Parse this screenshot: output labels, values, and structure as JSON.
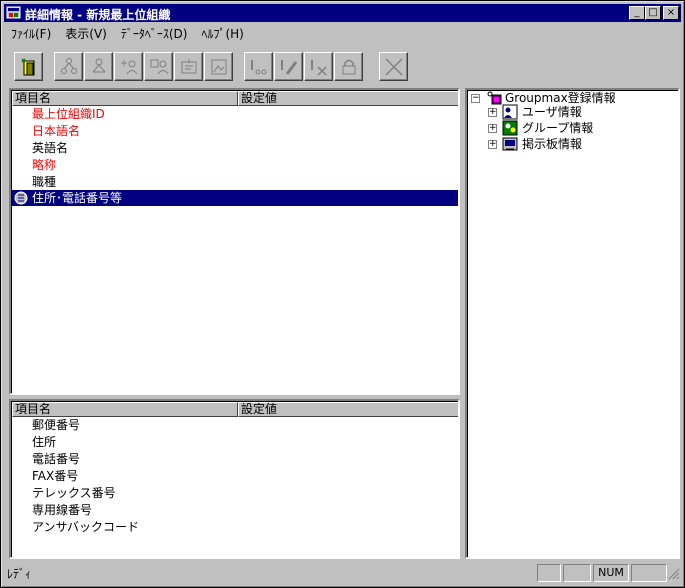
{
  "window": {
    "title": "詳細情報 - 新規最上位組織",
    "minimize": "_",
    "maximize": "□",
    "close": "×"
  },
  "menu": [
    "ﾌｧｲﾙ(F)",
    "表示(V)",
    "ﾃﾞｰﾀﾍﾞｰｽ(D)",
    "ﾍﾙﾌﾟ(H)"
  ],
  "toolbar": {
    "buttons": [
      "new-organization-icon",
      "organization-tree-icon",
      "organization-node-icon",
      "add-member-icon",
      "members-icon",
      "edit-item-icon",
      "image-view-icon",
      "connect-icon",
      "edit-pencil-icon",
      "cut-link-icon",
      "lock-icon",
      "delete-x-icon"
    ]
  },
  "top_table": {
    "col_item": "項目名",
    "col_value": "設定値",
    "rows": [
      {
        "label": "最上位組織ID",
        "color": "#ff0000",
        "selected": false
      },
      {
        "label": "日本語名",
        "color": "#ff0000",
        "selected": false
      },
      {
        "label": "英語名",
        "color": "#000000",
        "selected": false
      },
      {
        "label": "略称",
        "color": "#ff0000",
        "selected": false
      },
      {
        "label": "職種",
        "color": "#000000",
        "selected": false
      },
      {
        "label": "住所･電話番号等",
        "color": "#ffffff",
        "selected": true,
        "icon": "address-book-icon"
      }
    ]
  },
  "bottom_table": {
    "col_item": "項目名",
    "col_value": "設定値",
    "rows": [
      "郵便番号",
      "住所",
      "電話番号",
      "FAX番号",
      "テレックス番号",
      "専用線番号",
      "アンサバックコード"
    ]
  },
  "tree": {
    "root": {
      "label": "Groupmax登録情報",
      "expander": "−"
    },
    "children": [
      {
        "label": "ユーザ情報",
        "expander": "+",
        "icon": "user-info-icon"
      },
      {
        "label": "グループ情報",
        "expander": "+",
        "icon": "group-info-icon"
      },
      {
        "label": "掲示板情報",
        "expander": "+",
        "icon": "bulletin-board-icon"
      }
    ]
  },
  "status": {
    "text": "ﾚﾃﾞｨ",
    "num": "NUM"
  }
}
